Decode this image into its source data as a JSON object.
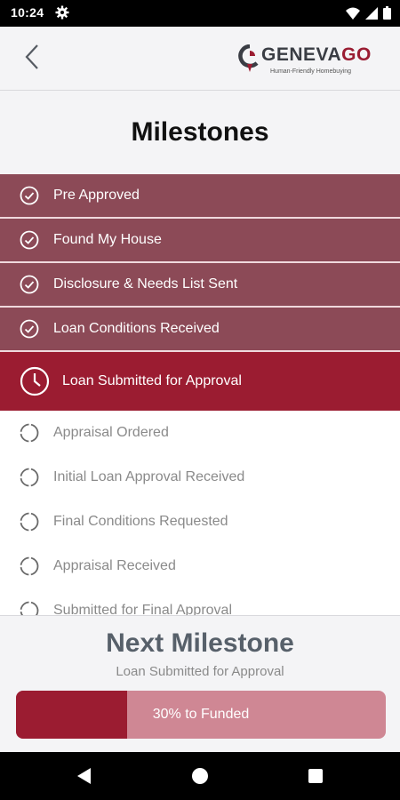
{
  "status_bar": {
    "time": "10:24",
    "icons": [
      "gear-icon",
      "wifi-icon",
      "signal-icon",
      "battery-icon"
    ]
  },
  "header": {
    "back_icon": "chevron-left-icon",
    "logo": {
      "text_a": "GENEVA",
      "text_b": "GO",
      "tagline": "Human-Friendly Homebuying"
    }
  },
  "page": {
    "title": "Milestones"
  },
  "milestones": [
    {
      "label": "Pre Approved",
      "status": "completed",
      "icon": "check-circle-icon"
    },
    {
      "label": "Found My House",
      "status": "completed",
      "icon": "check-circle-icon"
    },
    {
      "label": "Disclosure & Needs List Sent",
      "status": "completed",
      "icon": "check-circle-icon"
    },
    {
      "label": "Loan Conditions Received",
      "status": "completed",
      "icon": "check-circle-icon"
    },
    {
      "label": "Loan Submitted for Approval",
      "status": "current",
      "icon": "clock-icon"
    },
    {
      "label": "Appraisal Ordered",
      "status": "pending",
      "icon": "dashed-circle-icon"
    },
    {
      "label": "Initial Loan Approval Received",
      "status": "pending",
      "icon": "dashed-circle-icon"
    },
    {
      "label": "Final Conditions Requested",
      "status": "pending",
      "icon": "dashed-circle-icon"
    },
    {
      "label": "Appraisal Received",
      "status": "pending",
      "icon": "dashed-circle-icon"
    },
    {
      "label": "Submitted for Final Approval",
      "status": "pending",
      "icon": "dashed-circle-icon"
    }
  ],
  "footer": {
    "next_title": "Next Milestone",
    "next_subtitle": "Loan Submitted for Approval",
    "progress_label": "30% to Funded",
    "progress_value": 0.3
  },
  "colors": {
    "brand": "#9b1c31",
    "completed_row": "#8c4a57",
    "progress_track": "#cf8794"
  },
  "nav_bar": {
    "icons": [
      "back-triangle-icon",
      "home-circle-icon",
      "recents-square-icon"
    ]
  }
}
